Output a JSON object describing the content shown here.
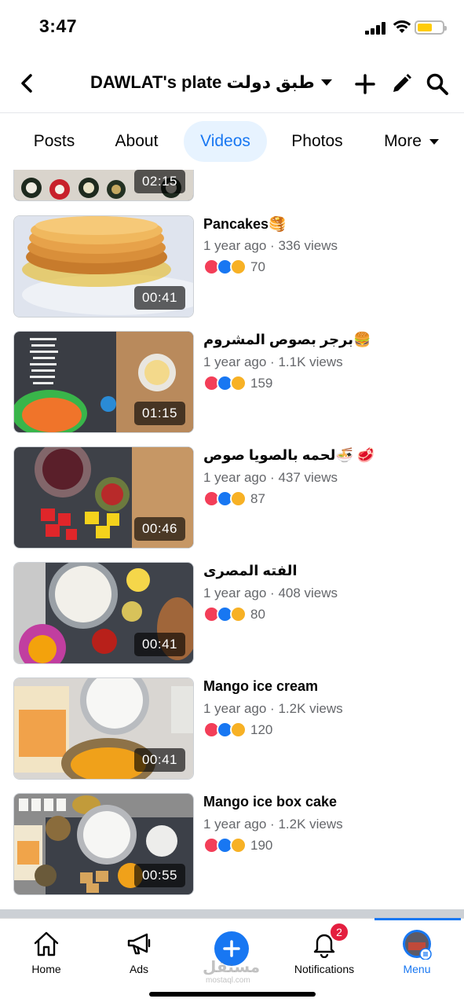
{
  "status_bar": {
    "time": "3:47"
  },
  "header": {
    "title": "DAWLAT's plate طبق دولت"
  },
  "tabs": [
    {
      "label": "Posts"
    },
    {
      "label": "About"
    },
    {
      "label": "Videos",
      "active": true
    },
    {
      "label": "Photos"
    },
    {
      "label": "More"
    }
  ],
  "partial_video": {
    "duration": "02:15"
  },
  "videos": [
    {
      "title": "Pancakes🥞",
      "meta": "1 year ago · 336 views",
      "reactions": "70",
      "duration": "00:41"
    },
    {
      "title": "برجر بصوص المشروم🍔",
      "meta": "1 year ago · 1.1K views",
      "reactions": "159",
      "duration": "01:15"
    },
    {
      "title": "لحمه بالصويا صوص🍜 🥩",
      "meta": "1 year ago · 437 views",
      "reactions": "87",
      "duration": "00:46"
    },
    {
      "title": "الفته المصرى",
      "meta": "1 year ago · 408 views",
      "reactions": "80",
      "duration": "00:41"
    },
    {
      "title": "Mango ice cream",
      "meta": "1 year ago · 1.2K views",
      "reactions": "120",
      "duration": "00:41"
    },
    {
      "title": "Mango ice box cake",
      "meta": "1 year ago · 1.2K views",
      "reactions": "190",
      "duration": "00:55"
    }
  ],
  "bottom_nav": {
    "home": "Home",
    "ads": "Ads",
    "notifications": "Notifications",
    "notifications_badge": "2",
    "menu": "Menu"
  },
  "watermark": {
    "text": "مستقل",
    "sub": "mostaql.com"
  },
  "colors": {
    "accent": "#1877f2",
    "love": "#f33e58",
    "like": "#1877f2",
    "care": "#f7b125",
    "badge": "#e41e3f"
  }
}
